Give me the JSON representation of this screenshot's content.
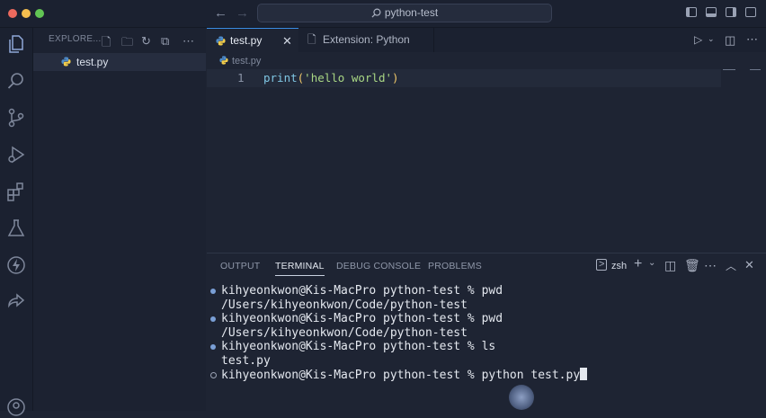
{
  "window": {
    "search_text": "python-test"
  },
  "sidebar": {
    "header": "EXPLORE...",
    "files": [
      {
        "label": "test.py"
      }
    ]
  },
  "editor": {
    "tabs": [
      {
        "label": "test.py",
        "active": true
      },
      {
        "label": "Extension: Python",
        "active": false
      }
    ],
    "breadcrumb": "test.py",
    "lines": [
      {
        "number": "1",
        "fn": "print",
        "open": "(",
        "string": "'hello world'",
        "close": ")"
      }
    ]
  },
  "panel": {
    "tabs": [
      "OUTPUT",
      "TERMINAL",
      "DEBUG CONSOLE",
      "PROBLEMS"
    ],
    "active_tab": "TERMINAL",
    "shell": "zsh",
    "terminal_lines": [
      {
        "text": "kihyeonkwon@Kis-MacPro python-test % pwd",
        "marker": "filled"
      },
      {
        "text": "/Users/kihyeonkwon/Code/python-test",
        "marker": "none"
      },
      {
        "text": "kihyeonkwon@Kis-MacPro python-test % pwd",
        "marker": "filled"
      },
      {
        "text": "/Users/kihyeonkwon/Code/python-test",
        "marker": "none"
      },
      {
        "text": "kihyeonkwon@Kis-MacPro python-test % ls",
        "marker": "filled"
      },
      {
        "text": "test.py",
        "marker": "none"
      },
      {
        "text": "kihyeonkwon@Kis-MacPro python-test % python test.py",
        "marker": "hollow"
      }
    ]
  },
  "colors": {
    "accent": "#3b8ee6",
    "background": "#1e2433",
    "string": "#a9d784",
    "function": "#7fc6e3"
  }
}
